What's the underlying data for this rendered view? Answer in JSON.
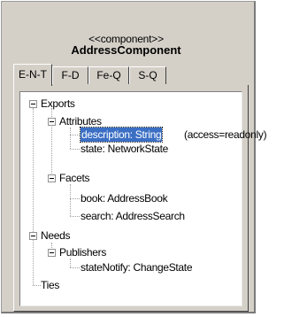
{
  "header": {
    "stereotype": "<<component>>",
    "component_name": "AddressComponent"
  },
  "tabs": [
    {
      "label": "E-N-T",
      "active": true
    },
    {
      "label": "F-D",
      "active": false
    },
    {
      "label": "Fe-Q",
      "active": false
    },
    {
      "label": "S-Q",
      "active": false
    }
  ],
  "tree": {
    "exports": {
      "label": "Exports",
      "attributes": {
        "label": "Attributes",
        "items": [
          {
            "label": "description: String",
            "selected": true,
            "annotation": "(access=readonly)"
          },
          {
            "label": "state: NetworkState",
            "selected": false
          }
        ]
      },
      "facets": {
        "label": "Facets",
        "items": [
          {
            "label": "book: AddressBook"
          },
          {
            "label": "search: AddressSearch"
          }
        ]
      }
    },
    "needs": {
      "label": "Needs",
      "publishers": {
        "label": "Publishers",
        "items": [
          {
            "label": "stateNotify: ChangeState"
          }
        ]
      }
    },
    "ties": {
      "label": "Ties"
    }
  }
}
